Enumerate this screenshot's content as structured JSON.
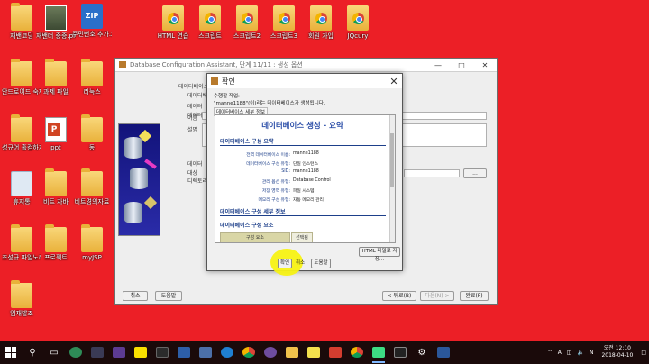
{
  "desktop": {
    "icons": [
      {
        "label": "재밴코딩",
        "type": "folder"
      },
      {
        "label": "재밴더 증증.png",
        "type": "photo"
      },
      {
        "label": "주민번호 추가.zip",
        "type": "zip"
      },
      {
        "label": "HTML 연습",
        "type": "chrome"
      },
      {
        "label": "스크립트",
        "type": "chrome"
      },
      {
        "label": "스크립트2",
        "type": "chrome"
      },
      {
        "label": "스크립트3",
        "type": "chrome"
      },
      {
        "label": "회원 가입",
        "type": "chrome"
      },
      {
        "label": "JQcury",
        "type": "chrome"
      },
      {
        "label": "안드로이드 숙제",
        "type": "folder"
      },
      {
        "label": "과제 파일",
        "type": "folder"
      },
      {
        "label": "리눅스",
        "type": "folder"
      },
      {
        "label": "성규어 홀컴하지",
        "type": "folder"
      },
      {
        "label": "ppt",
        "type": "pptx"
      },
      {
        "label": "동",
        "type": "folder"
      },
      {
        "label": "휴지통",
        "type": "recycle"
      },
      {
        "label": "비트 자바",
        "type": "folder"
      },
      {
        "label": "비트경의자료",
        "type": "folder"
      },
      {
        "label": "조성규 파일노리",
        "type": "folder"
      },
      {
        "label": "프로젝트",
        "type": "folder"
      },
      {
        "label": "myJSP",
        "type": "folder"
      },
      {
        "label": "임재발조",
        "type": "folder"
      }
    ]
  },
  "dbca": {
    "title": "Database Configuration Assistant, 단계 11/11 : 생성 옵션",
    "labels": [
      "데이터베이스 생",
      "데이터베",
      "데이터",
      "데이터베이스 세부 정보",
      "이름",
      "설명",
      "데이터",
      "대상",
      "디렉토리"
    ],
    "buttons": {
      "cancel": "취소",
      "help": "도움말",
      "back": "< 뒤로(B)",
      "next": "다음(N) >",
      "finish": "완료(F)"
    },
    "side_button": "..."
  },
  "dialog": {
    "title": "확인",
    "line1": "수행할 작업:",
    "line2": "\"manne1188\"(이)라는 데이터베이스가 생성됩니다.",
    "line3": "데이터베이스 세부 정보",
    "report": {
      "title": "데이터베이스 생성 - 요약",
      "section1": "데이터베이스 구성 요약",
      "rows": [
        {
          "k": "전역 데이터베이스 이름:",
          "v": "manne1188"
        },
        {
          "k": "데이터베이스 구성 유형:",
          "v": "단일 인스턴스"
        },
        {
          "k": "SID:",
          "v": "manne1188"
        },
        {
          "k": "관리 옵션 유형:",
          "v": "Database Control"
        },
        {
          "k": "저장 영역 유형:",
          "v": "파일 시스템"
        },
        {
          "k": "메모리 구성 유형:",
          "v": "자동 메모리 관리"
        }
      ],
      "section2": "데이터베이스 구성 세부 정보",
      "section3": "데이터베이스 구성 요소",
      "table_headers": [
        "구성 요소",
        "선택됨"
      ]
    },
    "buttons": {
      "html_save": "HTML 파일로 저장...",
      "ok": "확인",
      "cancel": "취소",
      "help": "도움말"
    }
  },
  "highlight_color": "#f7f213",
  "taskbar": {
    "icons": [
      "windows-start",
      "search",
      "task-view",
      "vs-code",
      "vs",
      "vs2017",
      "kakaotalk",
      "explorer-2",
      "azure",
      "edge",
      "chrome",
      "github",
      "file-explorer",
      "sticky",
      "java",
      "chrome-2",
      "android-studio",
      "terminal"
    ],
    "tray_text": [
      "^",
      "A",
      "N"
    ],
    "time": "오전 12:10",
    "date": "2018-04-10"
  }
}
